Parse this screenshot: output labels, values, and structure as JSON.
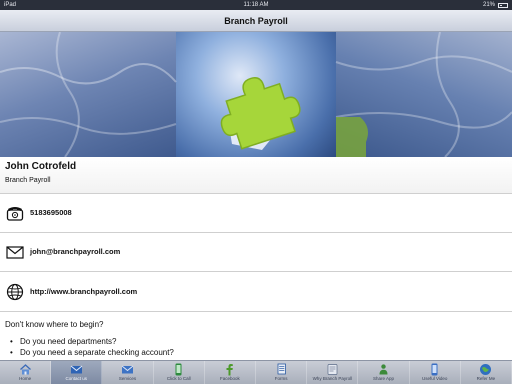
{
  "status_bar": {
    "device": "iPad",
    "time": "11:18 AM",
    "battery": "21%"
  },
  "nav": {
    "title": "Branch Payroll"
  },
  "banner": {
    "image": "puzzle-pieces-image"
  },
  "contact": {
    "name": "John Cotrofeld",
    "company": "Branch Payroll"
  },
  "rows": [
    {
      "icon": "phone-icon",
      "text": "5183695008"
    },
    {
      "icon": "envelope-icon",
      "text": "john@branchpayroll.com"
    },
    {
      "icon": "globe-icon",
      "text": "http://www.branchpayroll.com"
    }
  ],
  "info": {
    "title": "Don't know where to begin?",
    "items": [
      "Do you need departments?",
      "Do you need a separate checking account?"
    ]
  },
  "tabs": [
    {
      "label": "Home",
      "icon": "home-icon",
      "active": false
    },
    {
      "label": "Contact us",
      "icon": "contact-envelope-icon",
      "active": true
    },
    {
      "label": "Services",
      "icon": "services-envelope-icon",
      "active": false
    },
    {
      "label": "Click to Call",
      "icon": "phone-call-icon",
      "active": false
    },
    {
      "label": "Facebook",
      "icon": "facebook-icon",
      "active": false
    },
    {
      "label": "Forms",
      "icon": "forms-icon",
      "active": false
    },
    {
      "label": "Why Branch Payroll",
      "icon": "why-icon",
      "active": false
    },
    {
      "label": "Share App",
      "icon": "share-app-icon",
      "active": false
    },
    {
      "label": "Useful Video",
      "icon": "video-icon",
      "active": false
    },
    {
      "label": "Refer Me",
      "icon": "refer-me-icon",
      "active": false
    }
  ],
  "colors": {
    "accent": "#a6d63a",
    "tab_bar": "#b5bbc7",
    "banner": "#4c6597"
  }
}
